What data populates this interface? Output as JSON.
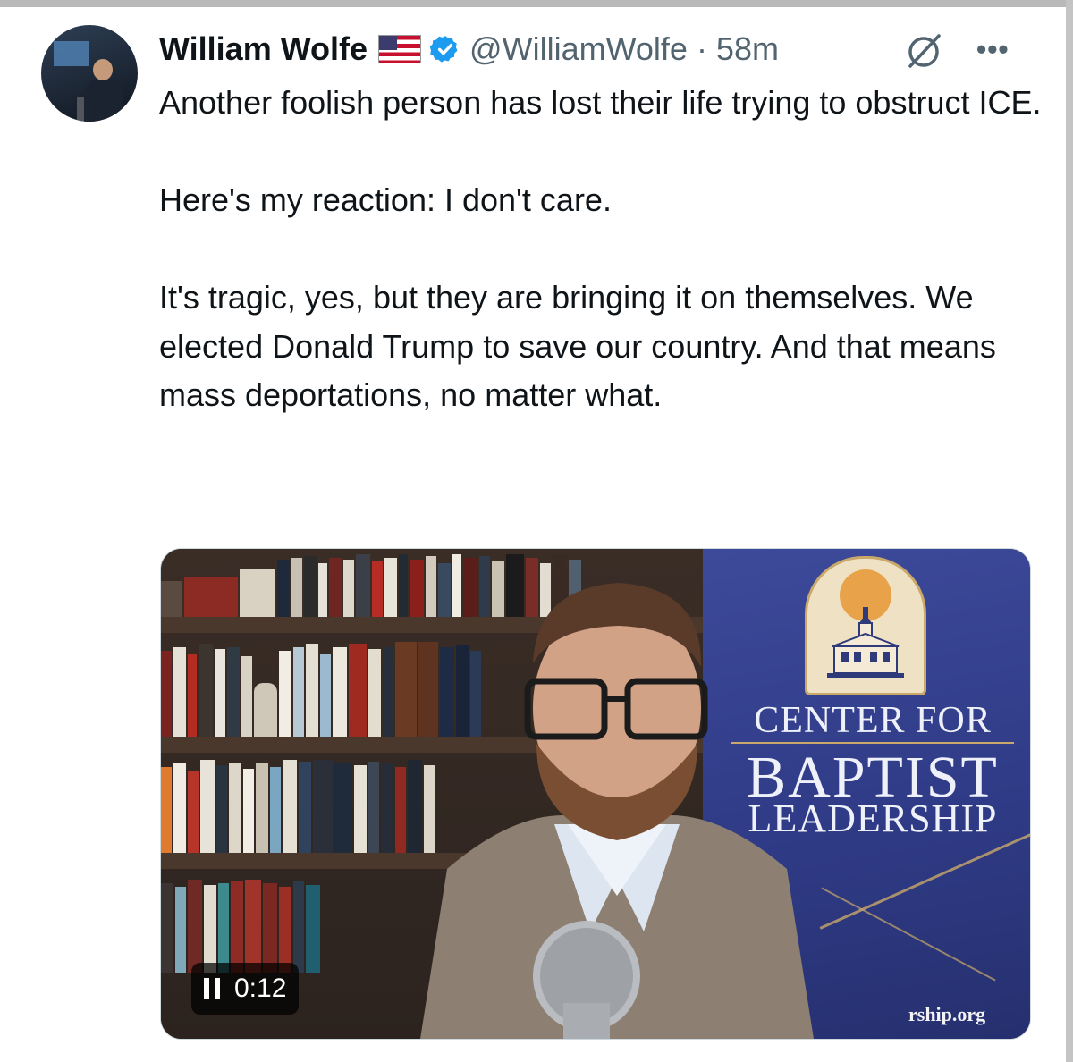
{
  "tweet": {
    "author_name": "William Wolfe",
    "flag_icon": "us-flag-emoji",
    "verified_icon": "verified-badge",
    "handle_and_time": "@WilliamWolfe · 58m",
    "paragraphs": [
      "Another foolish person has lost their life trying to obstruct ICE.",
      "Here's my reaction: I don't care.",
      "It's tragic, yes, but they are bringing it on themselves. We elected Donald Trump to save our country. And that means mass deportations, no matter what."
    ]
  },
  "media": {
    "banner_line1": "CENTER FOR",
    "banner_line2": "BAPTIST",
    "banner_line3": "LEADERSHIP",
    "banner_url": "rship.org",
    "timer": "0:12",
    "state_icon": "pause-icon"
  },
  "colors": {
    "text": "#0f1419",
    "secondary": "#536471",
    "verified": "#1d9bf0",
    "banner_blue": "#2f3b86"
  }
}
